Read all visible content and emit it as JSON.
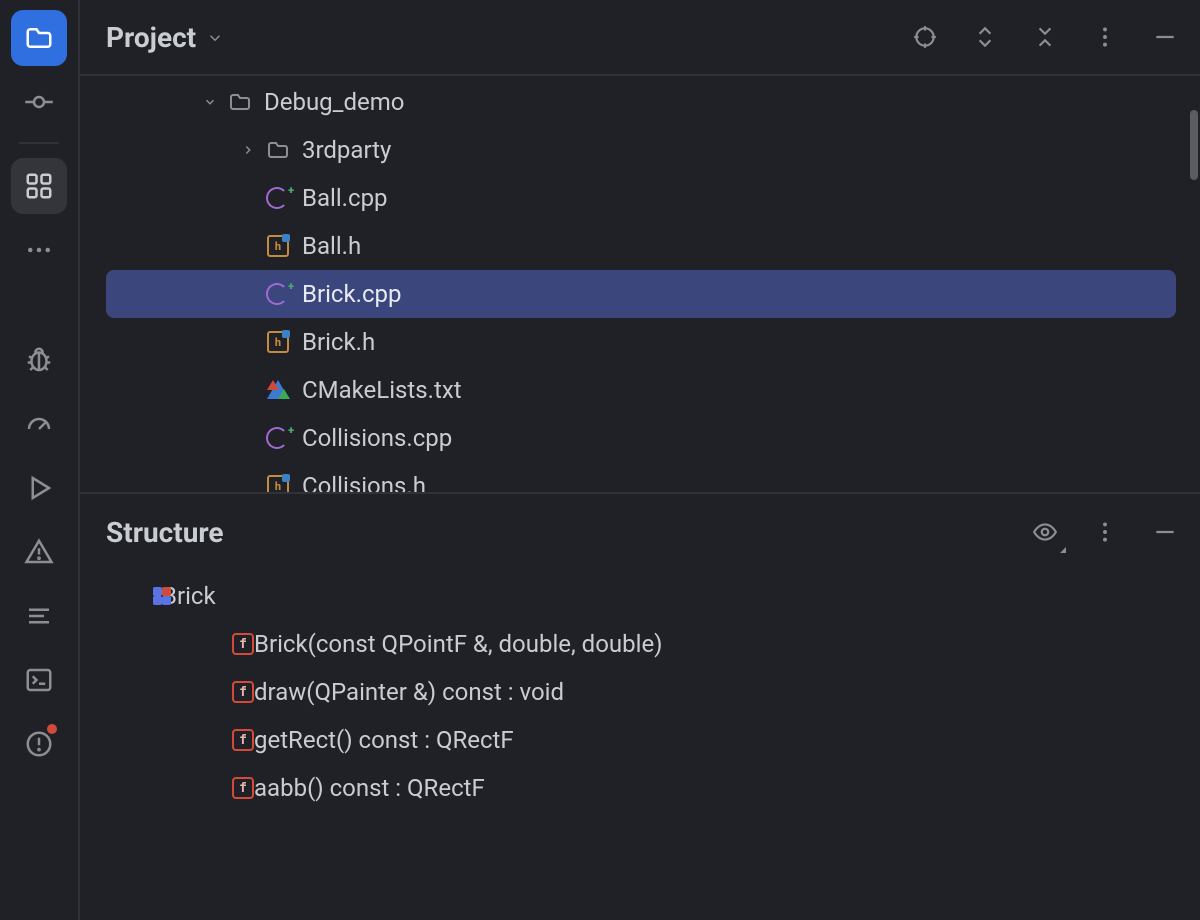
{
  "projectPanel": {
    "title": "Project",
    "scrollThumbVisible": true
  },
  "structurePanel": {
    "title": "Structure"
  },
  "activityBar": {
    "items": [
      {
        "name": "project-tool-icon",
        "kind": "folder-primary"
      },
      {
        "name": "commit-tool-icon",
        "kind": "commit"
      },
      {
        "name": "structure-tool-icon",
        "kind": "structure",
        "selected": true
      },
      {
        "name": "more-tools-icon",
        "kind": "more"
      },
      {
        "name": "debug-tool-icon",
        "kind": "bug"
      },
      {
        "name": "profiler-tool-icon",
        "kind": "gauge"
      },
      {
        "name": "run-tool-icon",
        "kind": "run"
      },
      {
        "name": "messages-tool-icon",
        "kind": "warning"
      },
      {
        "name": "todo-tool-icon",
        "kind": "lines"
      },
      {
        "name": "terminal-tool-icon",
        "kind": "terminal"
      },
      {
        "name": "problems-tool-icon",
        "kind": "problems",
        "notif": true
      }
    ]
  },
  "projectActions": [
    {
      "name": "locate-file-icon",
      "kind": "target"
    },
    {
      "name": "expand-all-icon",
      "kind": "updown"
    },
    {
      "name": "collapse-all-icon",
      "kind": "collapse"
    },
    {
      "name": "panel-options-icon",
      "kind": "vdots"
    },
    {
      "name": "hide-panel-icon",
      "kind": "minus"
    }
  ],
  "structureActions": [
    {
      "name": "view-options-icon",
      "kind": "eye"
    },
    {
      "name": "panel-options-icon",
      "kind": "vdots"
    },
    {
      "name": "hide-panel-icon",
      "kind": "minus"
    }
  ],
  "tree": [
    {
      "depth": 0,
      "twisty": "down",
      "icon": "folder",
      "label": "Debug_demo",
      "selected": false
    },
    {
      "depth": 1,
      "twisty": "right",
      "icon": "folder",
      "label": "3rdparty",
      "selected": false
    },
    {
      "depth": 1,
      "twisty": "",
      "icon": "cpp",
      "label": "Ball.cpp",
      "selected": false
    },
    {
      "depth": 1,
      "twisty": "",
      "icon": "hdr",
      "label": "Ball.h",
      "selected": false
    },
    {
      "depth": 1,
      "twisty": "",
      "icon": "cpp",
      "label": "Brick.cpp",
      "selected": true
    },
    {
      "depth": 1,
      "twisty": "",
      "icon": "hdr",
      "label": "Brick.h",
      "selected": false
    },
    {
      "depth": 1,
      "twisty": "",
      "icon": "cmake",
      "label": "CMakeLists.txt",
      "selected": false
    },
    {
      "depth": 1,
      "twisty": "",
      "icon": "cpp",
      "label": "Collisions.cpp",
      "selected": false
    },
    {
      "depth": 1,
      "twisty": "",
      "icon": "hdr",
      "label": "Collisions.h",
      "selected": false
    }
  ],
  "structure": {
    "root": {
      "twisty": "down",
      "icon": "class",
      "label": "Brick"
    },
    "members": [
      {
        "icon": "fn",
        "label": "Brick(const QPointF &, double, double)"
      },
      {
        "icon": "fn",
        "label": "draw(QPainter &) const : void"
      },
      {
        "icon": "fn",
        "label": "getRect() const : QRectF"
      },
      {
        "icon": "fn",
        "label": "aabb() const : QRectF"
      }
    ]
  }
}
